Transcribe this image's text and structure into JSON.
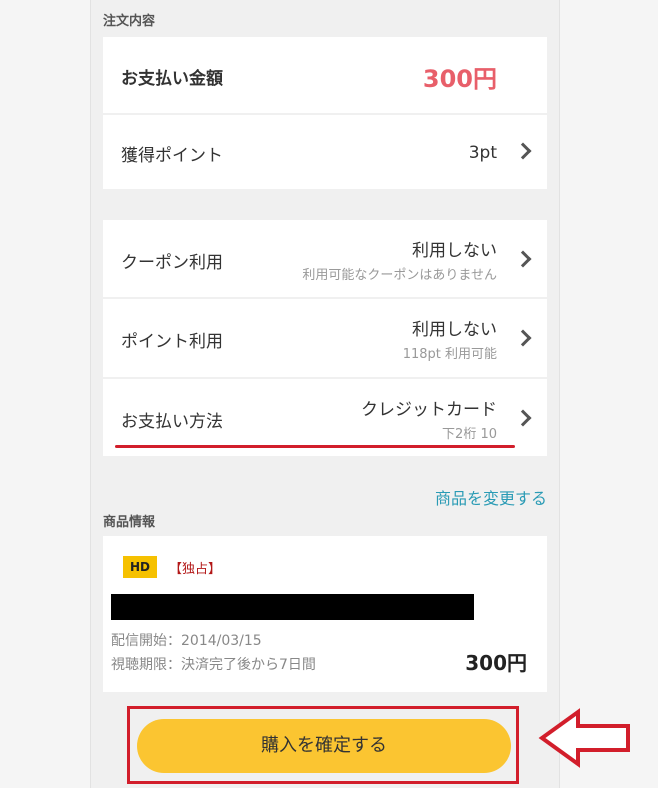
{
  "order": {
    "section_title": "注文内容",
    "amount_label": "お支払い金額",
    "amount_value": "300円",
    "points_label": "獲得ポイント",
    "points_value": "3pt"
  },
  "options": {
    "coupon_label": "クーポン利用",
    "coupon_value": "利用しない",
    "coupon_sub": "利用可能なクーポンはありません",
    "point_use_label": "ポイント利用",
    "point_use_value": "利用しない",
    "point_use_sub": "118pt 利用可能",
    "payment_label": "お支払い方法",
    "payment_value": "クレジットカード",
    "payment_sub": "下2桁 10"
  },
  "change_link": "商品を変更する",
  "product": {
    "section_title": "商品情報",
    "badge": "HD",
    "tag": "【独占】",
    "release": "配信開始：2014/03/15",
    "period": "視聴期限：決済完了後から7日間",
    "price": "300円"
  },
  "confirm_button": "購入を確定する",
  "colors": {
    "price_red": "#e85f6a",
    "link_blue": "#2a9bb5",
    "button_yellow": "#fbc531",
    "highlight_red": "#d21e2b",
    "badge_yellow": "#f6c100"
  }
}
